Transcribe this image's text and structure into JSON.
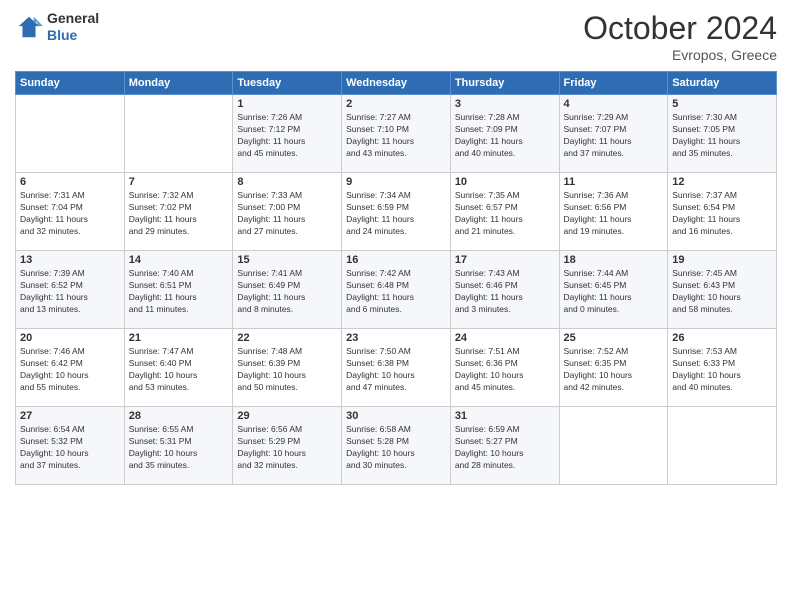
{
  "header": {
    "logo_general": "General",
    "logo_blue": "Blue",
    "month_title": "October 2024",
    "location": "Evropos, Greece"
  },
  "days_of_week": [
    "Sunday",
    "Monday",
    "Tuesday",
    "Wednesday",
    "Thursday",
    "Friday",
    "Saturday"
  ],
  "weeks": [
    [
      {
        "day": "",
        "info": ""
      },
      {
        "day": "",
        "info": ""
      },
      {
        "day": "1",
        "info": "Sunrise: 7:26 AM\nSunset: 7:12 PM\nDaylight: 11 hours\nand 45 minutes."
      },
      {
        "day": "2",
        "info": "Sunrise: 7:27 AM\nSunset: 7:10 PM\nDaylight: 11 hours\nand 43 minutes."
      },
      {
        "day": "3",
        "info": "Sunrise: 7:28 AM\nSunset: 7:09 PM\nDaylight: 11 hours\nand 40 minutes."
      },
      {
        "day": "4",
        "info": "Sunrise: 7:29 AM\nSunset: 7:07 PM\nDaylight: 11 hours\nand 37 minutes."
      },
      {
        "day": "5",
        "info": "Sunrise: 7:30 AM\nSunset: 7:05 PM\nDaylight: 11 hours\nand 35 minutes."
      }
    ],
    [
      {
        "day": "6",
        "info": "Sunrise: 7:31 AM\nSunset: 7:04 PM\nDaylight: 11 hours\nand 32 minutes."
      },
      {
        "day": "7",
        "info": "Sunrise: 7:32 AM\nSunset: 7:02 PM\nDaylight: 11 hours\nand 29 minutes."
      },
      {
        "day": "8",
        "info": "Sunrise: 7:33 AM\nSunset: 7:00 PM\nDaylight: 11 hours\nand 27 minutes."
      },
      {
        "day": "9",
        "info": "Sunrise: 7:34 AM\nSunset: 6:59 PM\nDaylight: 11 hours\nand 24 minutes."
      },
      {
        "day": "10",
        "info": "Sunrise: 7:35 AM\nSunset: 6:57 PM\nDaylight: 11 hours\nand 21 minutes."
      },
      {
        "day": "11",
        "info": "Sunrise: 7:36 AM\nSunset: 6:56 PM\nDaylight: 11 hours\nand 19 minutes."
      },
      {
        "day": "12",
        "info": "Sunrise: 7:37 AM\nSunset: 6:54 PM\nDaylight: 11 hours\nand 16 minutes."
      }
    ],
    [
      {
        "day": "13",
        "info": "Sunrise: 7:39 AM\nSunset: 6:52 PM\nDaylight: 11 hours\nand 13 minutes."
      },
      {
        "day": "14",
        "info": "Sunrise: 7:40 AM\nSunset: 6:51 PM\nDaylight: 11 hours\nand 11 minutes."
      },
      {
        "day": "15",
        "info": "Sunrise: 7:41 AM\nSunset: 6:49 PM\nDaylight: 11 hours\nand 8 minutes."
      },
      {
        "day": "16",
        "info": "Sunrise: 7:42 AM\nSunset: 6:48 PM\nDaylight: 11 hours\nand 6 minutes."
      },
      {
        "day": "17",
        "info": "Sunrise: 7:43 AM\nSunset: 6:46 PM\nDaylight: 11 hours\nand 3 minutes."
      },
      {
        "day": "18",
        "info": "Sunrise: 7:44 AM\nSunset: 6:45 PM\nDaylight: 11 hours\nand 0 minutes."
      },
      {
        "day": "19",
        "info": "Sunrise: 7:45 AM\nSunset: 6:43 PM\nDaylight: 10 hours\nand 58 minutes."
      }
    ],
    [
      {
        "day": "20",
        "info": "Sunrise: 7:46 AM\nSunset: 6:42 PM\nDaylight: 10 hours\nand 55 minutes."
      },
      {
        "day": "21",
        "info": "Sunrise: 7:47 AM\nSunset: 6:40 PM\nDaylight: 10 hours\nand 53 minutes."
      },
      {
        "day": "22",
        "info": "Sunrise: 7:48 AM\nSunset: 6:39 PM\nDaylight: 10 hours\nand 50 minutes."
      },
      {
        "day": "23",
        "info": "Sunrise: 7:50 AM\nSunset: 6:38 PM\nDaylight: 10 hours\nand 47 minutes."
      },
      {
        "day": "24",
        "info": "Sunrise: 7:51 AM\nSunset: 6:36 PM\nDaylight: 10 hours\nand 45 minutes."
      },
      {
        "day": "25",
        "info": "Sunrise: 7:52 AM\nSunset: 6:35 PM\nDaylight: 10 hours\nand 42 minutes."
      },
      {
        "day": "26",
        "info": "Sunrise: 7:53 AM\nSunset: 6:33 PM\nDaylight: 10 hours\nand 40 minutes."
      }
    ],
    [
      {
        "day": "27",
        "info": "Sunrise: 6:54 AM\nSunset: 5:32 PM\nDaylight: 10 hours\nand 37 minutes."
      },
      {
        "day": "28",
        "info": "Sunrise: 6:55 AM\nSunset: 5:31 PM\nDaylight: 10 hours\nand 35 minutes."
      },
      {
        "day": "29",
        "info": "Sunrise: 6:56 AM\nSunset: 5:29 PM\nDaylight: 10 hours\nand 32 minutes."
      },
      {
        "day": "30",
        "info": "Sunrise: 6:58 AM\nSunset: 5:28 PM\nDaylight: 10 hours\nand 30 minutes."
      },
      {
        "day": "31",
        "info": "Sunrise: 6:59 AM\nSunset: 5:27 PM\nDaylight: 10 hours\nand 28 minutes."
      },
      {
        "day": "",
        "info": ""
      },
      {
        "day": "",
        "info": ""
      }
    ]
  ]
}
